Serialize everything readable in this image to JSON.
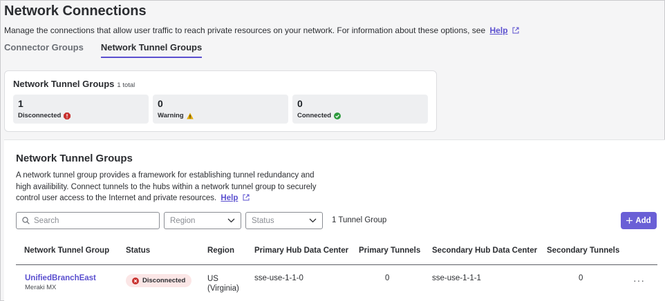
{
  "header": {
    "title": "Network Connections",
    "description": "Manage the connections that allow user traffic to reach private resources on your network. For information about these options, see",
    "help_label": "Help"
  },
  "tabs": [
    {
      "label": "Connector Groups",
      "active": false
    },
    {
      "label": "Network Tunnel Groups",
      "active": true
    }
  ],
  "summary": {
    "title": "Network Tunnel Groups",
    "total": "1 total",
    "stats": [
      {
        "value": "1",
        "label": "Disconnected",
        "icon": "error-icon",
        "color": "#c8322f"
      },
      {
        "value": "0",
        "label": "Warning",
        "icon": "warning-icon",
        "color": "#e0a800"
      },
      {
        "value": "0",
        "label": "Connected",
        "icon": "check-circle-icon",
        "color": "#2e9a3e"
      }
    ]
  },
  "main": {
    "title": "Network Tunnel Groups",
    "description": "A network tunnel group provides a framework for establishing tunnel redundancy and high availibility. Connect tunnels to the hubs within a network tunnel group to securely control user access to the Internet and private resources.",
    "help_label": "Help",
    "search_placeholder": "Search",
    "region_placeholder": "Region",
    "status_placeholder": "Status",
    "count_label": "1 Tunnel Group",
    "add_label": "Add"
  },
  "table": {
    "columns": [
      "Network Tunnel Group",
      "Status",
      "Region",
      "Primary Hub Data Center",
      "Primary Tunnels",
      "Secondary Hub Data Center",
      "Secondary Tunnels"
    ],
    "rows": [
      {
        "name": "UnifiedBranchEast",
        "device": "Meraki MX",
        "status": "Disconnected",
        "region_line1": "US",
        "region_line2": "(Virginia)",
        "primary_hub": "sse-use-1-1-0",
        "primary_tunnels": "0",
        "secondary_hub": "sse-use-1-1-1",
        "secondary_tunnels": "0",
        "actions": "···"
      }
    ]
  },
  "colors": {
    "accent": "#5a4fcf",
    "button": "#6a5fd6",
    "error": "#c8322f",
    "warning": "#e0a800",
    "success": "#2e9a3e"
  }
}
